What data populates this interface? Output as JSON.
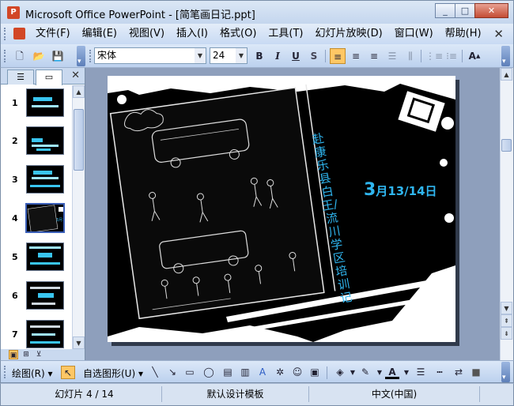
{
  "window": {
    "app_icon_letter": "P",
    "title": "Microsoft Office PowerPoint - [简笔画日记.ppt]",
    "buttons": {
      "minimize": "_",
      "maximize": "□",
      "close": "✕"
    }
  },
  "menu": {
    "items": [
      "文件(F)",
      "编辑(E)",
      "视图(V)",
      "插入(I)",
      "格式(O)",
      "工具(T)",
      "幻灯片放映(D)",
      "窗口(W)",
      "帮助(H)"
    ],
    "close": "✕"
  },
  "toolbar": {
    "font_name": "宋体",
    "font_size": "24",
    "bold": "B",
    "italic": "I",
    "underline": "U",
    "shadow": "S",
    "grow_font": "A"
  },
  "slides_pane": {
    "close": "✕",
    "thumbnails": [
      "1",
      "2",
      "3",
      "4",
      "5",
      "6",
      "7"
    ],
    "selected": "4"
  },
  "slide": {
    "date_prefix": "3",
    "date_main": "月13/14日",
    "vertical_text": "赴康乐县白王/流川学区培训记"
  },
  "drawbar": {
    "draw_label": "绘图(R)",
    "autoshapes_label": "自选图形(U)",
    "font_color": "A"
  },
  "status": {
    "slide_info": "幻灯片 4 / 14",
    "design": "默认设计模板",
    "language": "中文(中国)"
  },
  "colors": {
    "accent_cyan": "#2fb6f0",
    "title_bar": "#c4d6ee",
    "selection": "#ffc765"
  }
}
